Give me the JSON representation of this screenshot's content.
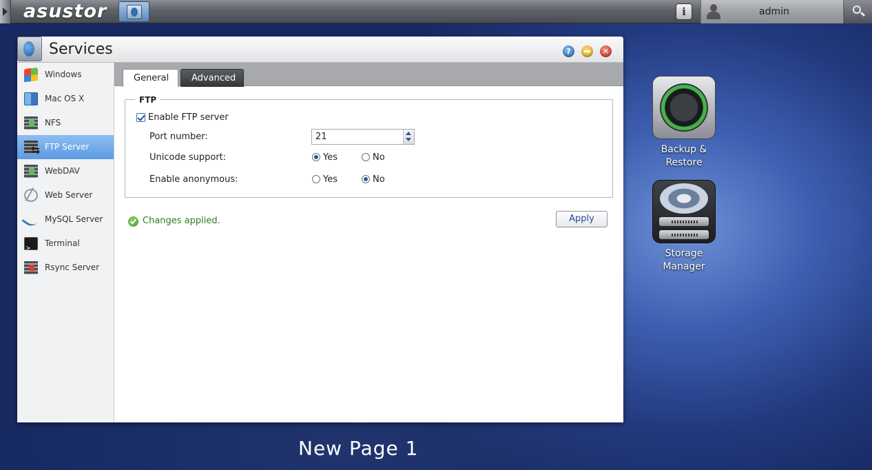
{
  "topbar": {
    "logo": "asustor",
    "username": "admin",
    "icons": [
      "app-launcher-icon",
      "info-icon",
      "user-icon",
      "search-icon"
    ]
  },
  "window": {
    "title": "Services",
    "controls": [
      "help-icon",
      "minimize-icon",
      "close-icon"
    ]
  },
  "sidebar": {
    "items": [
      {
        "label": "Windows",
        "icon": "windows-icon",
        "active": false
      },
      {
        "label": "Mac OS X",
        "icon": "mac-icon",
        "active": false
      },
      {
        "label": "NFS",
        "icon": "nfs-icon",
        "active": false
      },
      {
        "label": "FTP Server",
        "icon": "ftp-icon",
        "active": true
      },
      {
        "label": "WebDAV",
        "icon": "webdav-icon",
        "active": false
      },
      {
        "label": "Web Server",
        "icon": "web-server-icon",
        "active": false
      },
      {
        "label": "MySQL Server",
        "icon": "mysql-icon",
        "active": false
      },
      {
        "label": "Terminal",
        "icon": "terminal-icon",
        "active": false
      },
      {
        "label": "Rsync Server",
        "icon": "rsync-icon",
        "active": false
      }
    ]
  },
  "tabs": [
    {
      "label": "General",
      "active": true
    },
    {
      "label": "Advanced",
      "active": false
    }
  ],
  "ftp": {
    "legend": "FTP",
    "enable_label": "Enable FTP server",
    "enable_checked": true,
    "port_label": "Port number:",
    "port_value": "21",
    "unicode_label": "Unicode support:",
    "unicode_value": "Yes",
    "anonymous_label": "Enable anonymous:",
    "anonymous_value": "No",
    "yes_label": "Yes",
    "no_label": "No"
  },
  "status": {
    "message": "Changes applied.",
    "apply_label": "Apply"
  },
  "desktop": {
    "icons": [
      {
        "label_line1": "Backup &",
        "label_line2": "Restore",
        "icon": "backup-restore-icon"
      },
      {
        "label_line1": "Storage",
        "label_line2": "Manager",
        "icon": "storage-manager-icon"
      }
    ],
    "page_label": "New Page 1"
  }
}
